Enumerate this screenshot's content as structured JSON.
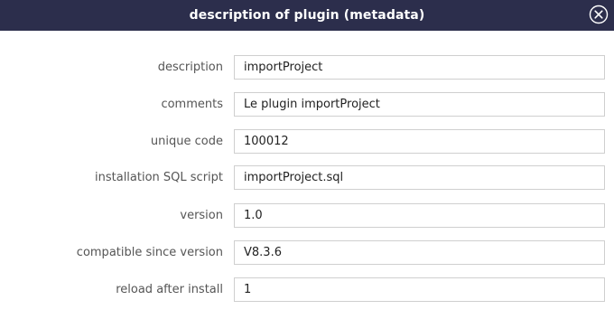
{
  "dialog": {
    "title": "description of plugin (metadata)",
    "close_icon": "close-circle-x-icon",
    "header_color": "#2c2e4c"
  },
  "fields": [
    {
      "label": "description",
      "value": "importProject"
    },
    {
      "label": "comments",
      "value": "Le plugin importProject"
    },
    {
      "label": "unique code",
      "value": "100012"
    },
    {
      "label": "installation SQL script",
      "value": "importProject.sql"
    },
    {
      "label": "version",
      "value": "1.0"
    },
    {
      "label": "compatible since version",
      "value": "V8.3.6"
    },
    {
      "label": "reload after install",
      "value": "1"
    }
  ]
}
